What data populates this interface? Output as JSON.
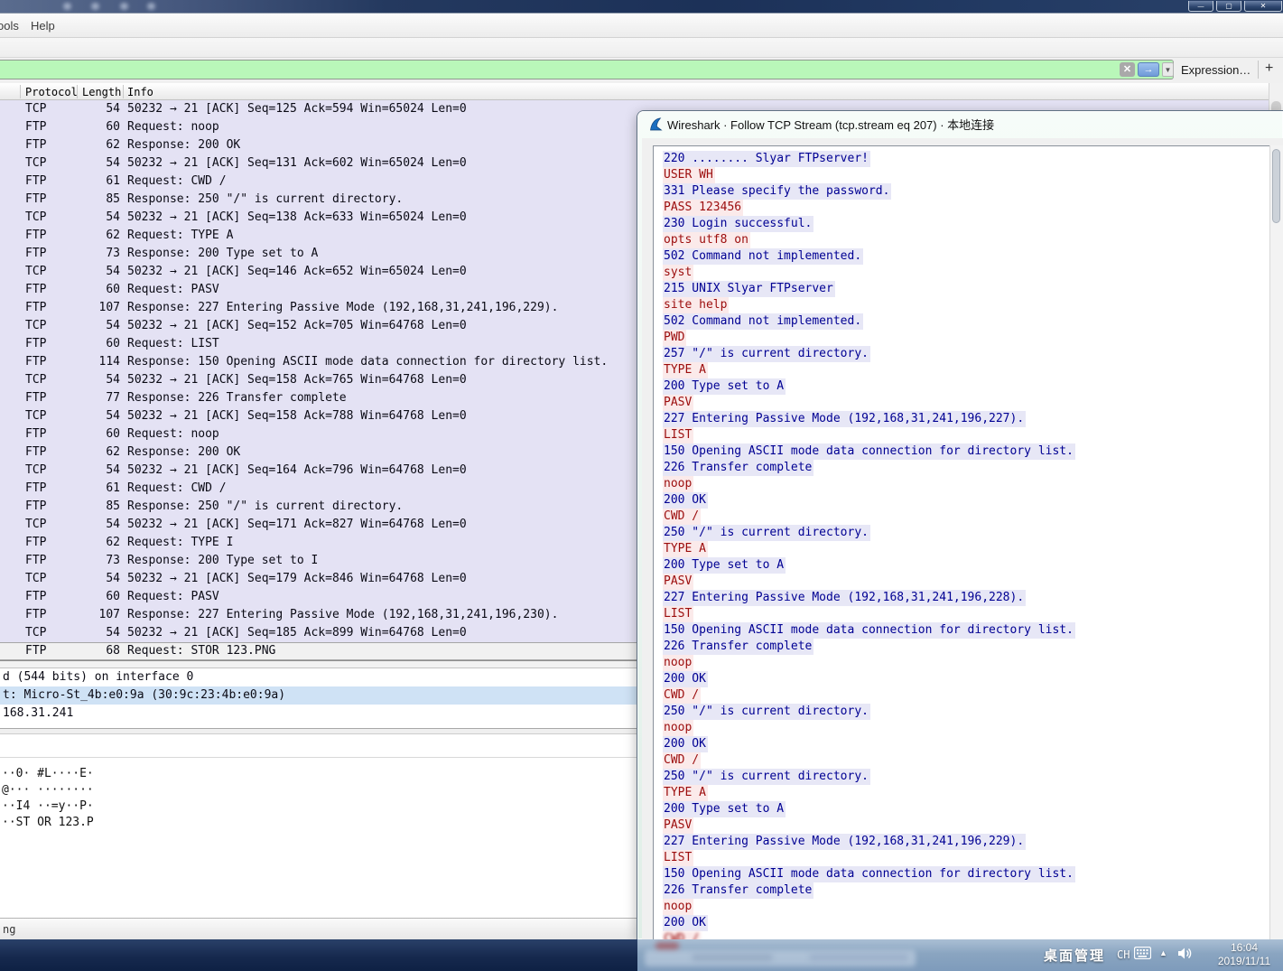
{
  "window": {
    "menu": [
      "ools",
      "Help"
    ],
    "controls": {
      "minimize": "—",
      "maximize": "▢",
      "close": "✕"
    }
  },
  "filter_bar": {
    "icons": {
      "clear": "✕",
      "apply": "→",
      "caret": "▼"
    },
    "expression_label": "Expression…",
    "add_label": "+",
    "field_color": "#b9f7b9"
  },
  "packet_list": {
    "columns": [
      "Protocol",
      "Length",
      "Info"
    ],
    "rows": [
      {
        "proto": "TCP",
        "len": "54",
        "info": "50232 → 21 [ACK] Seq=125 Ack=594 Win=65024 Len=0",
        "selected": false
      },
      {
        "proto": "FTP",
        "len": "60",
        "info": "Request: noop",
        "selected": false
      },
      {
        "proto": "FTP",
        "len": "62",
        "info": "Response: 200 OK",
        "selected": false
      },
      {
        "proto": "TCP",
        "len": "54",
        "info": "50232 → 21 [ACK] Seq=131 Ack=602 Win=65024 Len=0",
        "selected": false
      },
      {
        "proto": "FTP",
        "len": "61",
        "info": "Request: CWD /",
        "selected": false
      },
      {
        "proto": "FTP",
        "len": "85",
        "info": "Response: 250 \"/\" is current directory.",
        "selected": false
      },
      {
        "proto": "TCP",
        "len": "54",
        "info": "50232 → 21 [ACK] Seq=138 Ack=633 Win=65024 Len=0",
        "selected": false
      },
      {
        "proto": "FTP",
        "len": "62",
        "info": "Request: TYPE A",
        "selected": false
      },
      {
        "proto": "FTP",
        "len": "73",
        "info": "Response: 200 Type set to A",
        "selected": false
      },
      {
        "proto": "TCP",
        "len": "54",
        "info": "50232 → 21 [ACK] Seq=146 Ack=652 Win=65024 Len=0",
        "selected": false
      },
      {
        "proto": "FTP",
        "len": "60",
        "info": "Request: PASV",
        "selected": false
      },
      {
        "proto": "FTP",
        "len": "107",
        "info": "Response: 227 Entering Passive Mode (192,168,31,241,196,229).",
        "selected": false
      },
      {
        "proto": "TCP",
        "len": "54",
        "info": "50232 → 21 [ACK] Seq=152 Ack=705 Win=64768 Len=0",
        "selected": false
      },
      {
        "proto": "FTP",
        "len": "60",
        "info": "Request: LIST",
        "selected": false
      },
      {
        "proto": "FTP",
        "len": "114",
        "info": "Response: 150 Opening ASCII mode data connection for directory list.",
        "selected": false
      },
      {
        "proto": "TCP",
        "len": "54",
        "info": "50232 → 21 [ACK] Seq=158 Ack=765 Win=64768 Len=0",
        "selected": false
      },
      {
        "proto": "FTP",
        "len": "77",
        "info": "Response: 226 Transfer complete",
        "selected": false
      },
      {
        "proto": "TCP",
        "len": "54",
        "info": "50232 → 21 [ACK] Seq=158 Ack=788 Win=64768 Len=0",
        "selected": false
      },
      {
        "proto": "FTP",
        "len": "60",
        "info": "Request: noop",
        "selected": false
      },
      {
        "proto": "FTP",
        "len": "62",
        "info": "Response: 200 OK",
        "selected": false
      },
      {
        "proto": "TCP",
        "len": "54",
        "info": "50232 → 21 [ACK] Seq=164 Ack=796 Win=64768 Len=0",
        "selected": false
      },
      {
        "proto": "FTP",
        "len": "61",
        "info": "Request: CWD /",
        "selected": false
      },
      {
        "proto": "FTP",
        "len": "85",
        "info": "Response: 250 \"/\" is current directory.",
        "selected": false
      },
      {
        "proto": "TCP",
        "len": "54",
        "info": "50232 → 21 [ACK] Seq=171 Ack=827 Win=64768 Len=0",
        "selected": false
      },
      {
        "proto": "FTP",
        "len": "62",
        "info": "Request: TYPE I",
        "selected": false
      },
      {
        "proto": "FTP",
        "len": "73",
        "info": "Response: 200 Type set to I",
        "selected": false
      },
      {
        "proto": "TCP",
        "len": "54",
        "info": "50232 → 21 [ACK] Seq=179 Ack=846 Win=64768 Len=0",
        "selected": false
      },
      {
        "proto": "FTP",
        "len": "60",
        "info": "Request: PASV",
        "selected": false
      },
      {
        "proto": "FTP",
        "len": "107",
        "info": "Response: 227 Entering Passive Mode (192,168,31,241,196,230).",
        "selected": false
      },
      {
        "proto": "TCP",
        "len": "54",
        "info": "50232 → 21 [ACK] Seq=185 Ack=899 Win=64768 Len=0",
        "selected": false
      },
      {
        "proto": "FTP",
        "len": "68",
        "info": "Request: STOR 123.PNG",
        "selected": true
      }
    ]
  },
  "details_pane": {
    "lines": [
      {
        "text": "d (544 bits) on interface 0",
        "highlighted": false
      },
      {
        "text": "t: Micro-St_4b:e0:9a (30:9c:23:4b:e0:9a)",
        "highlighted": true
      },
      {
        "text": "168.31.241",
        "highlighted": false
      }
    ]
  },
  "hex_pane": {
    "lines": [
      "··0· #L····E·",
      "@··· ········",
      "··I4 ··=y··P·",
      "··ST OR 123.P"
    ]
  },
  "status_bar": {
    "text": "ng"
  },
  "dialog": {
    "title": "Wireshark · Follow TCP Stream (tcp.stream eq 207) · 本地连接",
    "stream_colors": {
      "client_text": "#9c0d0d",
      "client_bg": "#fbeaea",
      "server_text": "#000093",
      "server_bg": "#e7e7f6"
    },
    "stream": [
      {
        "role": "server",
        "text": "220 ........ Slyar FTPserver!",
        "partial": false
      },
      {
        "role": "client",
        "text": "USER WH",
        "partial": false
      },
      {
        "role": "server",
        "text": "331 Please specify the password.",
        "partial": false
      },
      {
        "role": "client",
        "text": "PASS 123456",
        "partial": false
      },
      {
        "role": "server",
        "text": "230 Login successful.",
        "partial": false
      },
      {
        "role": "client",
        "text": "opts utf8 on",
        "partial": false
      },
      {
        "role": "server",
        "text": "502 Command not implemented.",
        "partial": false
      },
      {
        "role": "client",
        "text": "syst",
        "partial": false
      },
      {
        "role": "server",
        "text": "215 UNIX Slyar FTPserver",
        "partial": false
      },
      {
        "role": "client",
        "text": "site help",
        "partial": false
      },
      {
        "role": "server",
        "text": "502 Command not implemented.",
        "partial": false
      },
      {
        "role": "client",
        "text": "PWD",
        "partial": false
      },
      {
        "role": "server",
        "text": "257 \"/\" is current directory.",
        "partial": false
      },
      {
        "role": "client",
        "text": "TYPE A",
        "partial": false
      },
      {
        "role": "server",
        "text": "200 Type set to A",
        "partial": false
      },
      {
        "role": "client",
        "text": "PASV",
        "partial": false
      },
      {
        "role": "server",
        "text": "227 Entering Passive Mode (192,168,31,241,196,227).",
        "partial": false
      },
      {
        "role": "client",
        "text": "LIST",
        "partial": false
      },
      {
        "role": "server",
        "text": "150 Opening ASCII mode data connection for directory list.",
        "partial": false
      },
      {
        "role": "server",
        "text": "226 Transfer complete",
        "partial": false
      },
      {
        "role": "client",
        "text": "noop",
        "partial": false
      },
      {
        "role": "server",
        "text": "200 OK",
        "partial": false
      },
      {
        "role": "client",
        "text": "CWD /",
        "partial": false
      },
      {
        "role": "server",
        "text": "250 \"/\" is current directory.",
        "partial": false
      },
      {
        "role": "client",
        "text": "TYPE A",
        "partial": false
      },
      {
        "role": "server",
        "text": "200 Type set to A",
        "partial": false
      },
      {
        "role": "client",
        "text": "PASV",
        "partial": false
      },
      {
        "role": "server",
        "text": "227 Entering Passive Mode (192,168,31,241,196,228).",
        "partial": false
      },
      {
        "role": "client",
        "text": "LIST",
        "partial": false
      },
      {
        "role": "server",
        "text": "150 Opening ASCII mode data connection for directory list.",
        "partial": false
      },
      {
        "role": "server",
        "text": "226 Transfer complete",
        "partial": false
      },
      {
        "role": "client",
        "text": "noop",
        "partial": false
      },
      {
        "role": "server",
        "text": "200 OK",
        "partial": false
      },
      {
        "role": "client",
        "text": "CWD /",
        "partial": false
      },
      {
        "role": "server",
        "text": "250 \"/\" is current directory.",
        "partial": false
      },
      {
        "role": "client",
        "text": "noop",
        "partial": false
      },
      {
        "role": "server",
        "text": "200 OK",
        "partial": false
      },
      {
        "role": "client",
        "text": "CWD /",
        "partial": false
      },
      {
        "role": "server",
        "text": "250 \"/\" is current directory.",
        "partial": false
      },
      {
        "role": "client",
        "text": "TYPE A",
        "partial": false
      },
      {
        "role": "server",
        "text": "200 Type set to A",
        "partial": false
      },
      {
        "role": "client",
        "text": "PASV",
        "partial": false
      },
      {
        "role": "server",
        "text": "227 Entering Passive Mode (192,168,31,241,196,229).",
        "partial": false
      },
      {
        "role": "client",
        "text": "LIST",
        "partial": false
      },
      {
        "role": "server",
        "text": "150 Opening ASCII mode data connection for directory list.",
        "partial": false
      },
      {
        "role": "server",
        "text": "226 Transfer complete",
        "partial": false
      },
      {
        "role": "client",
        "text": "noop",
        "partial": false
      },
      {
        "role": "server",
        "text": "200 OK",
        "partial": false
      },
      {
        "role": "client",
        "text": "CWD /",
        "partial": true
      }
    ]
  },
  "taskbar": {
    "desktop_label": "桌面管理",
    "lang_indicator": "CH",
    "tray_expand_glyph": "▲",
    "time": "16:04",
    "date": "2019/11/11"
  }
}
